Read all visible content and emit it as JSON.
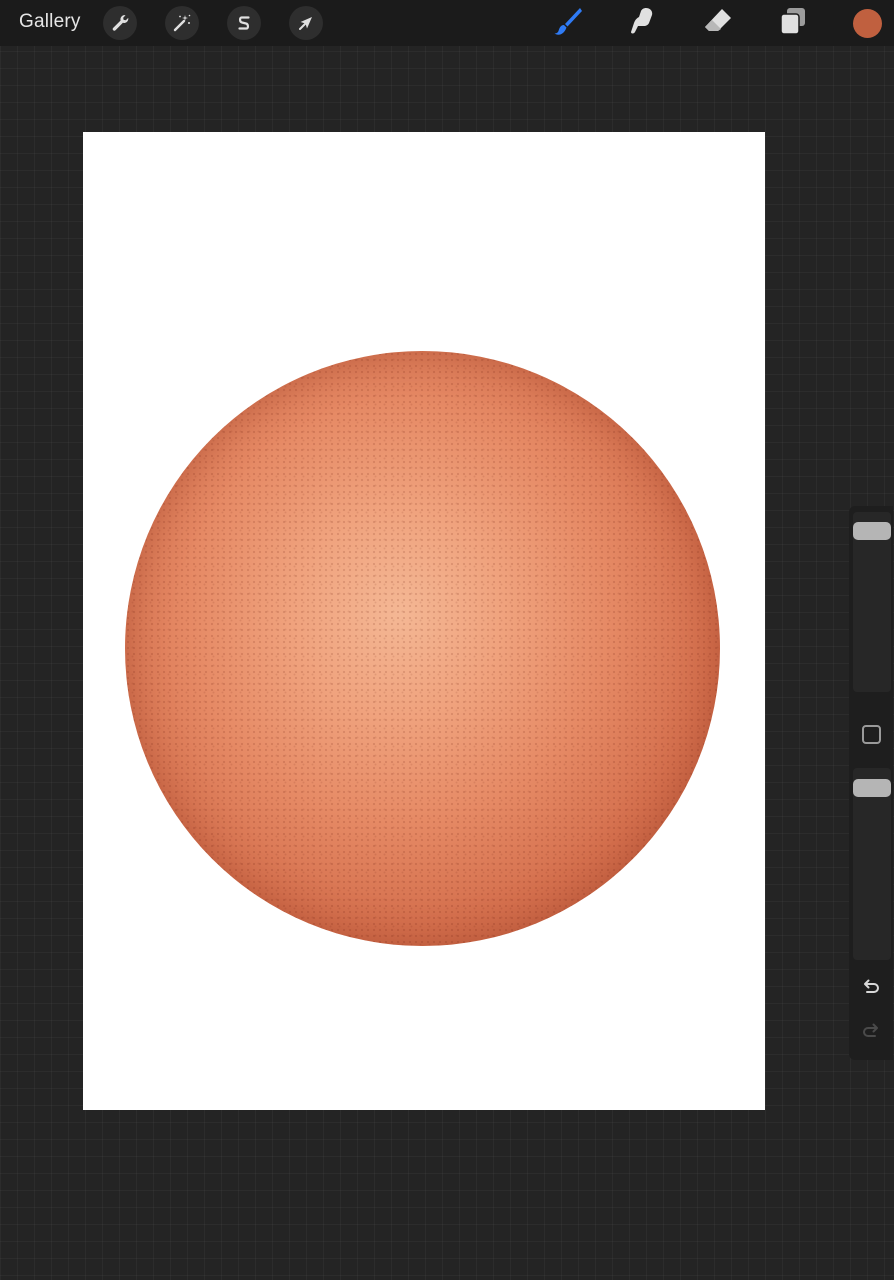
{
  "topbar": {
    "gallery_label": "Gallery",
    "left_tools": [
      {
        "name": "actions",
        "icon": "wrench-icon"
      },
      {
        "name": "adjustments",
        "icon": "magic-wand-icon"
      },
      {
        "name": "selection",
        "icon": "selection-s-icon"
      },
      {
        "name": "transform",
        "icon": "arrow-cursor-icon"
      }
    ],
    "right_tools": [
      {
        "name": "brush",
        "icon": "brush-icon",
        "active": true
      },
      {
        "name": "smudge",
        "icon": "smudge-finger-icon",
        "active": false
      },
      {
        "name": "eraser",
        "icon": "eraser-icon",
        "active": false
      },
      {
        "name": "layers",
        "icon": "layers-icon",
        "active": false
      }
    ],
    "current_color": "#c0603f"
  },
  "colors": {
    "accent": "#2f7bf5",
    "icon": "#e0e0e0",
    "sphere_light": "#f4b794",
    "sphere_dark": "#b9573b"
  },
  "sidebar": {
    "brush_size_level": 0.04,
    "opacity_level": 0.04,
    "undo_icon": "undo-icon",
    "redo_icon": "redo-icon",
    "modify_icon": "square-modify-icon"
  }
}
